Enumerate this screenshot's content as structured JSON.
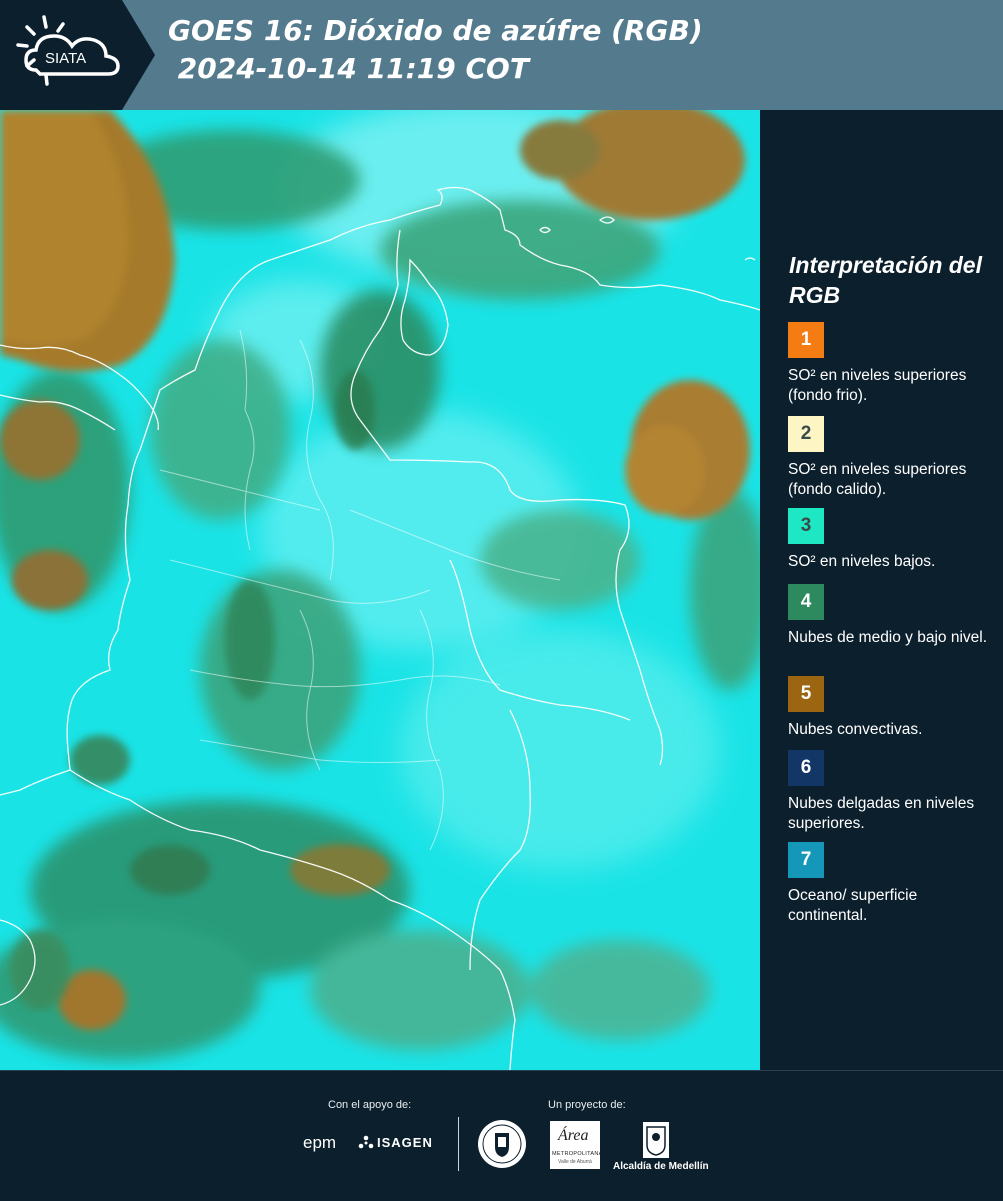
{
  "header": {
    "logo_text": "SIATA",
    "title_line1": "GOES 16: Dióxido de azúfre (RGB)",
    "title_line2": " 2024-10-14 11:19 COT"
  },
  "map": {
    "icon": "satellite-composite-image"
  },
  "legend": {
    "title": "Interpretación del RGB",
    "items": [
      {
        "number": "1",
        "color": "#f47c12",
        "text": "SO² en niveles superiores (fondo frio)."
      },
      {
        "number": "2",
        "color": "#fdf6c4",
        "text": "SO² en niveles superiores (fondo calido)."
      },
      {
        "number": "3",
        "color": "#1ee8c4",
        "text": "SO² en niveles bajos."
      },
      {
        "number": "4",
        "color": "#2d8a5e",
        "text": "Nubes de medio y bajo nivel."
      },
      {
        "number": "5",
        "color": "#9c6512",
        "text": "Nubes convectivas."
      },
      {
        "number": "6",
        "color": "#123766",
        "text": "Nubes delgadas en niveles superiores."
      },
      {
        "number": "7",
        "color": "#1497b8",
        "text": "Oceano/ superficie continental."
      }
    ]
  },
  "footer": {
    "support_label": "Con el apoyo de:",
    "project_label": "Un proyecto de:",
    "logos": {
      "epm": "epm",
      "isagen": "ISAGEN",
      "area_top": "Área",
      "area_bottom": "METROPOLITANA",
      "area_sub": "Valle de Aburrá",
      "alcaldia": "Alcaldía de Medellín"
    }
  }
}
